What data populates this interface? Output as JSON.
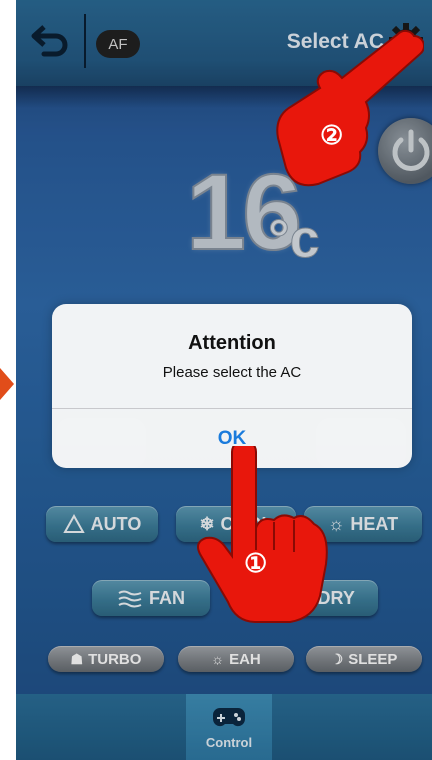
{
  "header": {
    "af_label": "AF",
    "title": "Select AC"
  },
  "display": {
    "temperature": "16",
    "unit": "°c"
  },
  "modes": {
    "auto": "AUTO",
    "cool": "COOL",
    "heat": "HEAT",
    "fan": "FAN",
    "dry": "DRY"
  },
  "functions": {
    "turbo": "TURBO",
    "eah": "EAH",
    "sleep": "SLEEP"
  },
  "bottom_nav": {
    "control_label": "Control"
  },
  "dialog": {
    "title": "Attention",
    "message": "Please select the AC",
    "ok_label": "OK"
  },
  "annotations": {
    "step1": "①",
    "step2": "②",
    "hand_color": "#e8170c"
  }
}
